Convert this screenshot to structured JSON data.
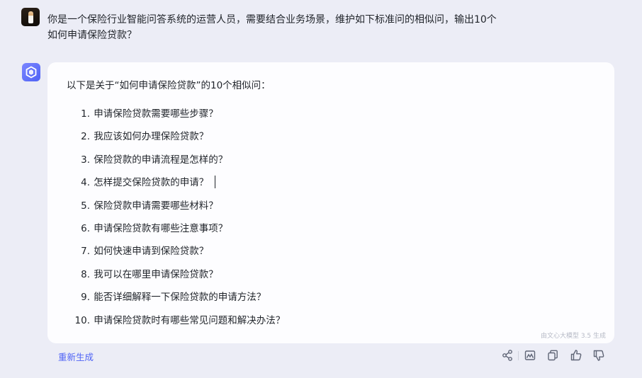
{
  "user_message": {
    "line1": "你是一个保险行业智能问答系统的运营人员，需要结合业务场景，维护如下标准问的相似问，输出10个",
    "line2": "如何申请保险贷款？"
  },
  "bot_message": {
    "intro": "以下是关于“如何申请保险贷款”的10个相似问：",
    "items": [
      {
        "num": "1.",
        "text": "申请保险贷款需要哪些步骤？"
      },
      {
        "num": "2.",
        "text": "我应该如何办理保险贷款？"
      },
      {
        "num": "3.",
        "text": "保险贷款的申请流程是怎样的？"
      },
      {
        "num": "4.",
        "text": "怎样提交保险贷款的申请？"
      },
      {
        "num": "5.",
        "text": "保险贷款申请需要哪些材料？"
      },
      {
        "num": "6.",
        "text": "申请保险贷款有哪些注意事项？"
      },
      {
        "num": "7.",
        "text": "如何快速申请到保险贷款？"
      },
      {
        "num": "8.",
        "text": "我可以在哪里申请保险贷款？"
      },
      {
        "num": "9.",
        "text": "能否详细解释一下保险贷款的申请方法？"
      },
      {
        "num": "10.",
        "text": "申请保险贷款时有哪些常见问题和解决办法？"
      }
    ],
    "generated_by": "由文心大模型 3.5 生成"
  },
  "footer": {
    "regenerate_label": "重新生成",
    "icons": [
      "share-icon",
      "image-icon",
      "copy-icon",
      "thumbs-up-icon",
      "thumbs-down-icon"
    ]
  },
  "colors": {
    "background": "#ecedf6",
    "bubble": "#fdfdff",
    "accent": "#4f63f5",
    "text": "#1f2329"
  }
}
